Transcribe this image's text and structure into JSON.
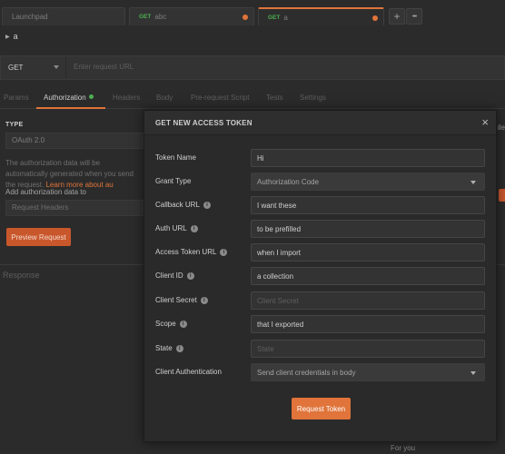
{
  "tabs": [
    {
      "label": "Launchpad",
      "method": "",
      "unsaved": false
    },
    {
      "label": "abc",
      "method": "GET",
      "unsaved": true
    },
    {
      "label": "a",
      "method": "GET",
      "unsaved": true
    }
  ],
  "tab_actions": {
    "add": "+",
    "more": "•••"
  },
  "request": {
    "name": "a",
    "method": "GET",
    "url_placeholder": "Enter request URL"
  },
  "subtabs": [
    {
      "label": "Params"
    },
    {
      "label": "Authorization"
    },
    {
      "label": "Headers"
    },
    {
      "label": "Body"
    },
    {
      "label": "Pre-request Script"
    },
    {
      "label": "Tests"
    },
    {
      "label": "Settings"
    }
  ],
  "auth": {
    "type_label": "TYPE",
    "type_value": "OAuth 2.0",
    "description": "The authorization data will be automatically generated when",
    "description2": "you send the request.",
    "learn_more": "Learn more about au",
    "add_to_label": "Add authorization data to",
    "add_to_value": "Request Headers",
    "preview_button": "Preview Request",
    "right_peek": "ile"
  },
  "response_label": "Response",
  "footer_text": "For you",
  "modal": {
    "title": "GET NEW ACCESS TOKEN",
    "close": "×",
    "info_glyph": "i",
    "fields": [
      {
        "label": "Token Name",
        "info": false,
        "value": "Hi",
        "placeholder": "",
        "type": "text"
      },
      {
        "label": "Grant Type",
        "info": false,
        "value": "Authorization Code",
        "placeholder": "",
        "type": "select"
      },
      {
        "label": "Callback URL",
        "info": true,
        "value": "I want these",
        "placeholder": "",
        "type": "text"
      },
      {
        "label": "Auth URL",
        "info": true,
        "value": "to be prefilled",
        "placeholder": "",
        "type": "text"
      },
      {
        "label": "Access Token URL",
        "info": true,
        "value": "when I import",
        "placeholder": "",
        "type": "text"
      },
      {
        "label": "Client ID",
        "info": true,
        "value": "a collection",
        "placeholder": "",
        "type": "text"
      },
      {
        "label": "Client Secret",
        "info": true,
        "value": "",
        "placeholder": "Client Secret",
        "type": "text"
      },
      {
        "label": "Scope",
        "info": true,
        "value": "that I exported",
        "placeholder": "",
        "type": "text"
      },
      {
        "label": "State",
        "info": true,
        "value": "",
        "placeholder": "State",
        "type": "text"
      },
      {
        "label": "Client Authentication",
        "info": false,
        "value": "Send client credentials in body",
        "placeholder": "",
        "type": "select"
      }
    ],
    "submit_button": "Request Token"
  },
  "colors": {
    "accent": "#e0743a",
    "get_method": "#4caf50",
    "background": "#2b2b2b",
    "modal": "#2a2a2a"
  }
}
